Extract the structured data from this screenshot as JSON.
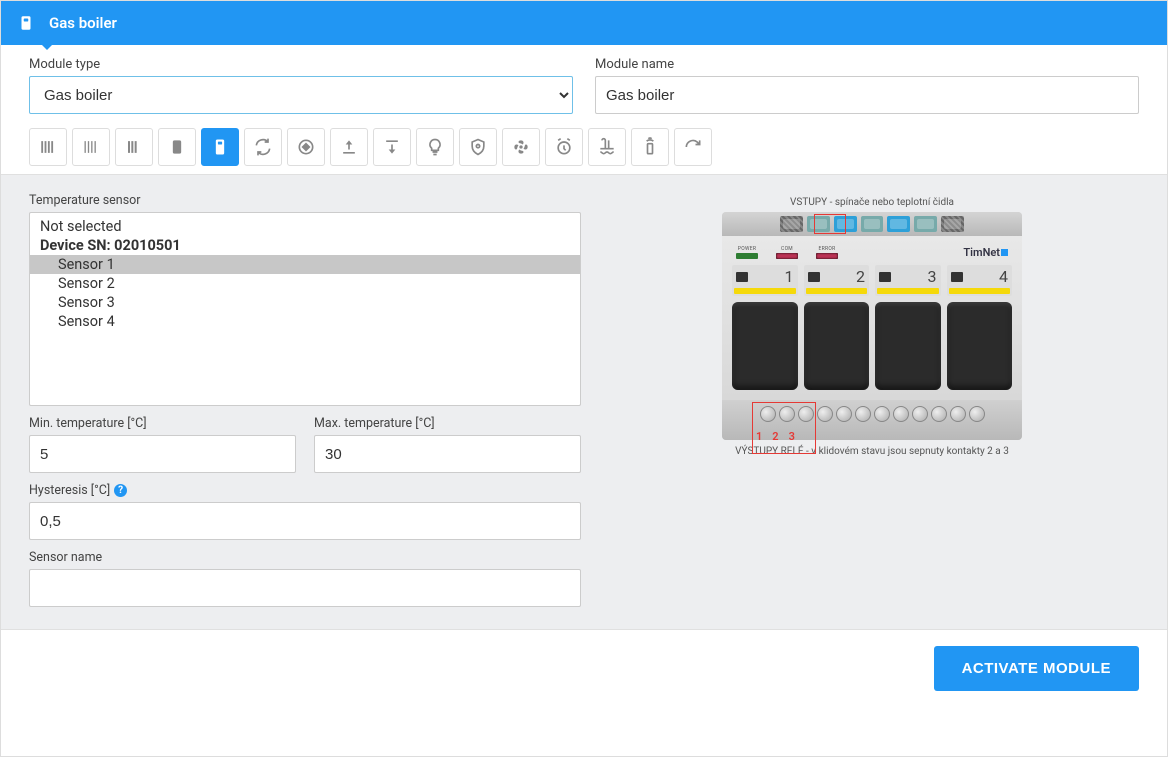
{
  "header": {
    "title": "Gas boiler"
  },
  "module_type": {
    "label": "Module type",
    "value": "Gas boiler"
  },
  "module_name": {
    "label": "Module name",
    "value": "Gas boiler"
  },
  "icon_buttons": [
    {
      "name": "blinds-1-icon",
      "active": false
    },
    {
      "name": "blinds-2-icon",
      "active": false
    },
    {
      "name": "blinds-3-icon",
      "active": false
    },
    {
      "name": "heater-icon",
      "active": false
    },
    {
      "name": "boiler-icon",
      "active": true
    },
    {
      "name": "sync-icon",
      "active": false
    },
    {
      "name": "updown-icon",
      "active": false
    },
    {
      "name": "level-up-icon",
      "active": false
    },
    {
      "name": "level-down-icon",
      "active": false
    },
    {
      "name": "bulb-icon",
      "active": false
    },
    {
      "name": "shield-icon",
      "active": false
    },
    {
      "name": "fan-icon",
      "active": false
    },
    {
      "name": "alarm-icon",
      "active": false
    },
    {
      "name": "pool-icon",
      "active": false
    },
    {
      "name": "remote-icon",
      "active": false
    },
    {
      "name": "redo-icon",
      "active": false
    }
  ],
  "sensor": {
    "label": "Temperature sensor",
    "items": [
      {
        "label": "Not selected",
        "type": "plain"
      },
      {
        "label": "Device SN: 02010501",
        "type": "device"
      },
      {
        "label": "Sensor 1",
        "type": "child",
        "selected": true
      },
      {
        "label": "Sensor 2",
        "type": "child",
        "selected": false
      },
      {
        "label": "Sensor 3",
        "type": "child",
        "selected": false
      },
      {
        "label": "Sensor 4",
        "type": "child",
        "selected": false
      }
    ]
  },
  "min_temp": {
    "label": "Min. temperature [°C]",
    "value": "5"
  },
  "max_temp": {
    "label": "Max. temperature [°C]",
    "value": "30"
  },
  "hysteresis": {
    "label": "Hysteresis [°C]",
    "value": "0,5"
  },
  "sensor_name": {
    "label": "Sensor name",
    "value": ""
  },
  "device_illustration": {
    "top_label": "VSTUPY - spínače nebo teplotní čidla",
    "bottom_label": "VÝSTUPY RELÉ - v klidovém stavu jsou sepnuty kontakty 2 a 3",
    "brand": "TimNet",
    "status": {
      "power": "POWER",
      "com": "COM",
      "error": "ERROR"
    },
    "channels": [
      "1",
      "2",
      "3",
      "4"
    ],
    "bottom_nums": [
      "1",
      "2",
      "3"
    ]
  },
  "footer": {
    "activate": "ACTIVATE MODULE"
  }
}
